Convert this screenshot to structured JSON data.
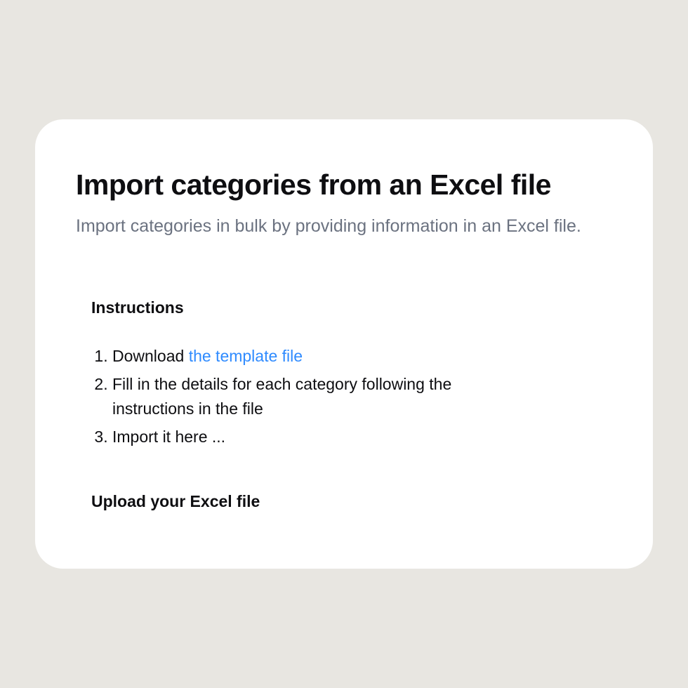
{
  "header": {
    "title": "Import categories from an Excel file",
    "subtitle": "Import categories in bulk by providing information in an Excel file."
  },
  "instructions": {
    "heading": "Instructions",
    "step1_prefix": "Download ",
    "step1_link": "the template file",
    "step2": "Fill in the details for each category following the instructions in the file",
    "step3": "Import it here ..."
  },
  "upload": {
    "heading": "Upload your Excel file"
  }
}
